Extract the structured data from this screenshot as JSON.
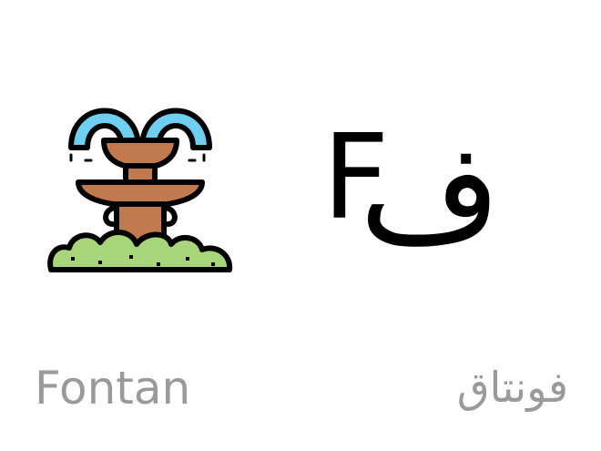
{
  "letters": {
    "latin": "F",
    "arabic": "ف"
  },
  "words": {
    "latin": "Fontan",
    "arabic": "فونتاق"
  },
  "illustration": {
    "icon": "fountain-icon"
  },
  "colors": {
    "background": "#ffffff",
    "letter": "#000000",
    "word": "#9a9a9a",
    "water": "#6fcff0",
    "stone": "#c07a4e",
    "bush": "#a9d57a",
    "outline": "#000000"
  }
}
